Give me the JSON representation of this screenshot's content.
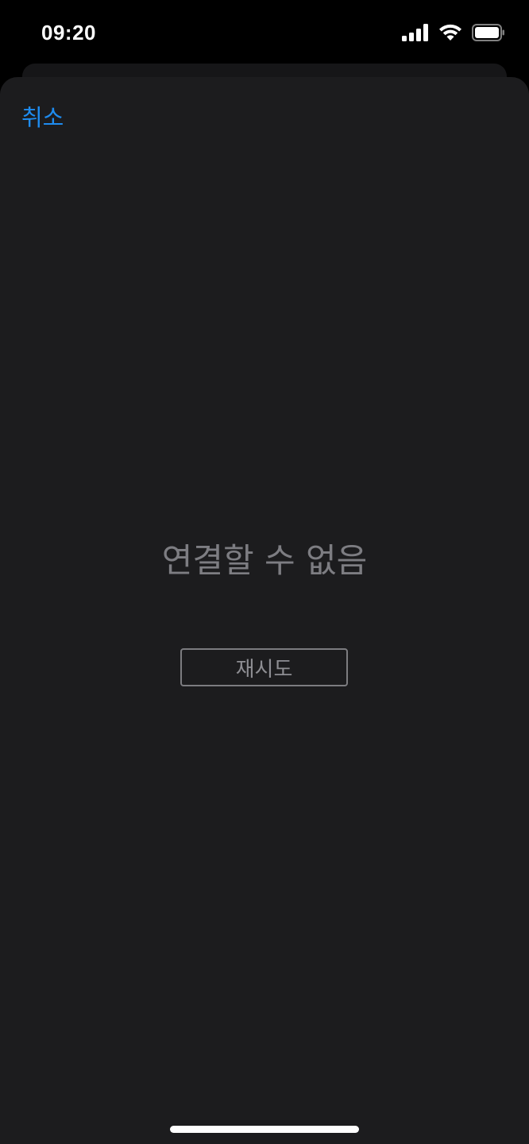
{
  "status_bar": {
    "time": "09:20",
    "icons": [
      "cellular-signal-icon",
      "wifi-icon",
      "battery-icon"
    ]
  },
  "sheet": {
    "cancel_label": "취소",
    "error_message": "연결할 수 없음",
    "retry_label": "재시도"
  },
  "colors": {
    "accent": "#1e8cf0",
    "sheet_background": "#1c1c1e",
    "muted_text": "#7d7d82"
  }
}
